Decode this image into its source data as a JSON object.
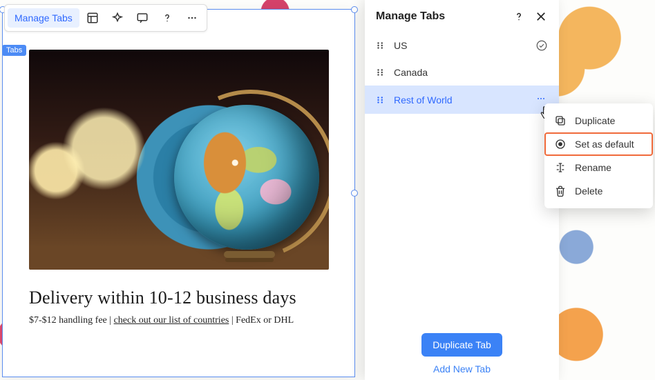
{
  "toolbar": {
    "manage_tabs": "Manage Tabs"
  },
  "selection": {
    "tag": "Tabs"
  },
  "content": {
    "heading": "Delivery within 10-12 business days",
    "sub_before": "$7-$12 handling fee | ",
    "sub_link": "check out our list of countries",
    "sub_after": " | FedEx or DHL"
  },
  "panel": {
    "title": "Manage Tabs",
    "tabs": [
      {
        "label": "US",
        "is_default": true
      },
      {
        "label": "Canada",
        "is_default": false
      },
      {
        "label": "Rest of World",
        "is_default": false
      }
    ],
    "duplicate_btn": "Duplicate Tab",
    "add_btn": "Add New Tab"
  },
  "ctx": {
    "duplicate": "Duplicate",
    "set_default": "Set as default",
    "rename": "Rename",
    "delete": "Delete"
  }
}
